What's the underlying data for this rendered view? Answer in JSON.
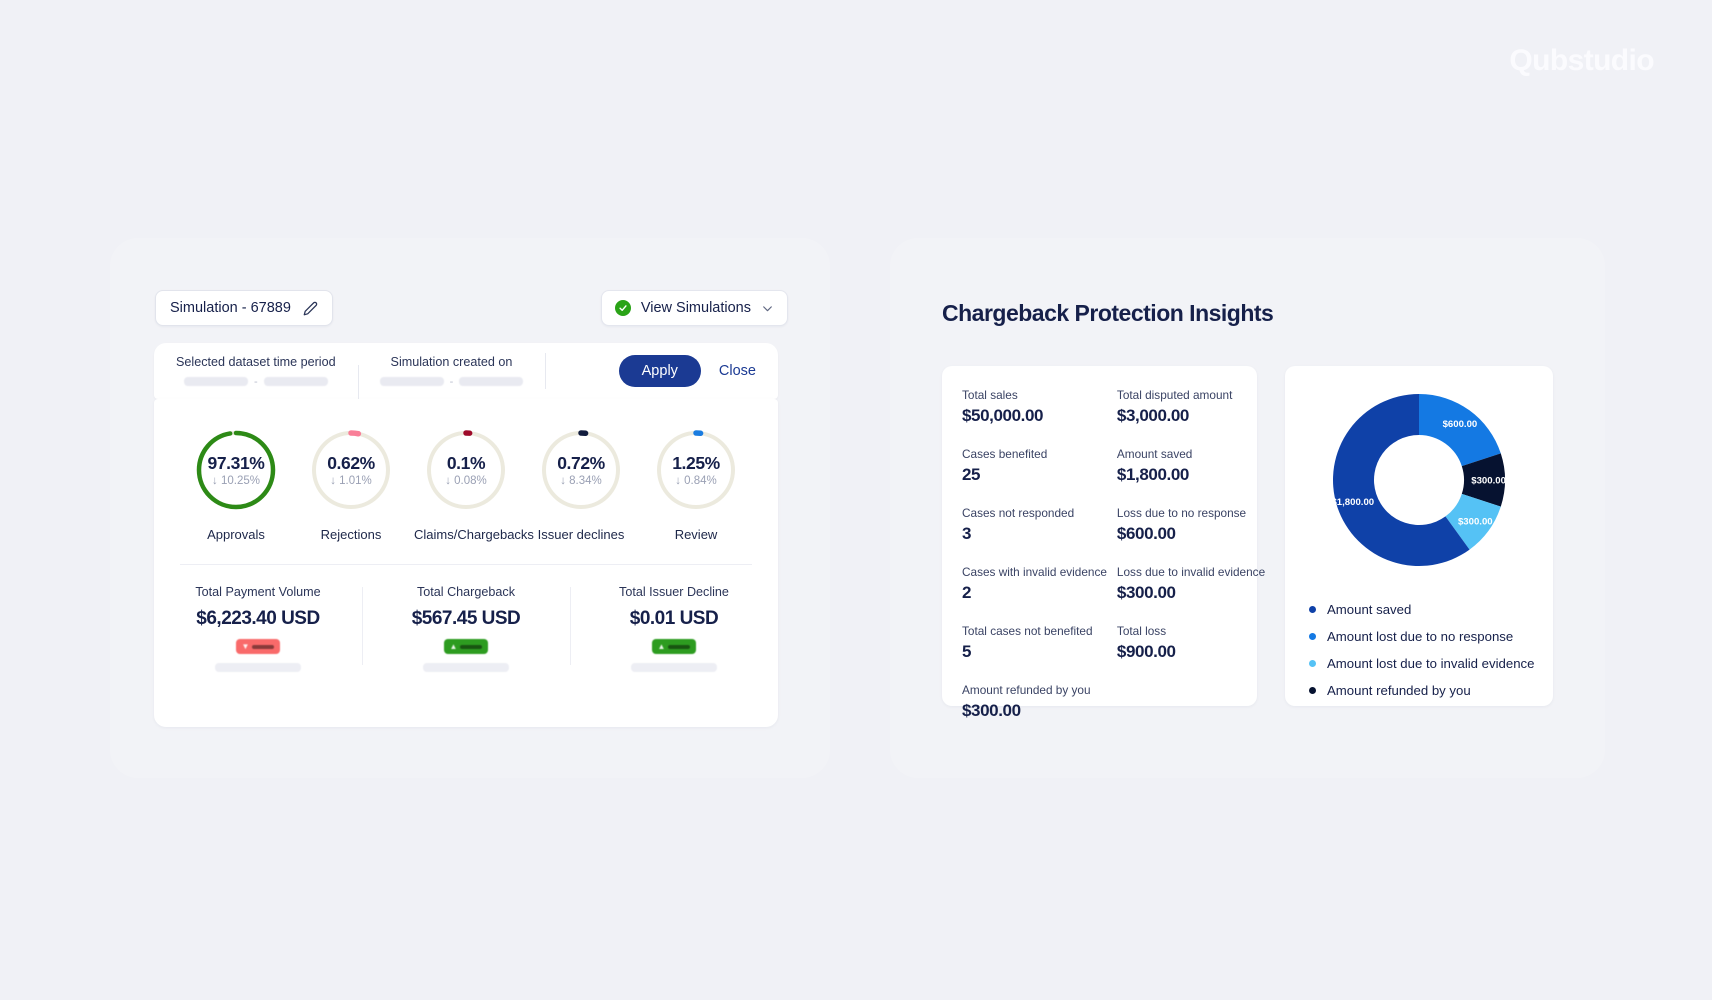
{
  "brand": "Qubstudio",
  "left_panel": {
    "simulation_chip": {
      "label": "Simulation - 67889",
      "edit_icon": "pencil-icon"
    },
    "view_simulations": {
      "label": "View Simulations",
      "status_icon": "check-circle-icon",
      "chevron_icon": "chevron-down-icon"
    },
    "filter_bar": {
      "col1_label": "Selected dataset time period",
      "col2_label": "Simulation created on",
      "range_separator": "-",
      "apply_label": "Apply",
      "close_label": "Close"
    },
    "gauges": [
      {
        "name": "Approvals",
        "percent": "97.31%",
        "delta": "↓ 10.25%",
        "value": 97.31,
        "color": "#2d8a16"
      },
      {
        "name": "Rejections",
        "percent": "0.62%",
        "delta": "↓ 1.01%",
        "value": 3.2,
        "color": "#f97f98"
      },
      {
        "name": "Claims/Chargebacks",
        "percent": "0.1%",
        "delta": "↓ 0.08%",
        "value": 1.6,
        "color": "#9e0b2a"
      },
      {
        "name": "Issuer declines",
        "percent": "0.72%",
        "delta": "↓ 8.34%",
        "value": 2.0,
        "color": "#111c3d"
      },
      {
        "name": "Review",
        "percent": "1.25%",
        "delta": "↓ 0.84%",
        "value": 2.0,
        "color": "#1a7ce0"
      }
    ],
    "gauge_track_color": "#eceade",
    "totals": [
      {
        "label": "Total Payment Volume",
        "value": "$6,223.40 USD",
        "trend": "down"
      },
      {
        "label": "Total Chargeback",
        "value": "$567.45 USD",
        "trend": "up"
      },
      {
        "label": "Total Issuer Decline",
        "value": "$0.01 USD",
        "trend": "up"
      }
    ]
  },
  "right_panel": {
    "title": "Chargeback Protection Insights",
    "stats": [
      {
        "label": "Total sales",
        "value": "$50,000.00"
      },
      {
        "label": "Total disputed amount",
        "value": "$3,000.00"
      },
      {
        "label": "Cases benefited",
        "value": "25"
      },
      {
        "label": "Amount saved",
        "value": "$1,800.00"
      },
      {
        "label": "Cases not responded",
        "value": "3"
      },
      {
        "label": "Loss due to no response",
        "value": "$600.00"
      },
      {
        "label": "Cases with invalid evidence",
        "value": "2"
      },
      {
        "label": "Loss due to invalid evidence",
        "value": "$300.00"
      },
      {
        "label": "Total cases not benefited",
        "value": "5"
      },
      {
        "label": "Total loss",
        "value": "$900.00"
      },
      {
        "label": "Amount refunded by you",
        "value": "$300.00"
      }
    ]
  },
  "chart_data": {
    "type": "pie",
    "title": "Chargeback Protection Insights",
    "subtype": "donut",
    "legend_position": "bottom",
    "categories": [
      "Amount saved",
      "Amount lost due to no response",
      "Amount lost due to invalid evidence",
      "Amount refunded by you"
    ],
    "values": [
      1800,
      600,
      300,
      300
    ],
    "labels": [
      "$1,800.00",
      "$600.00",
      "$300.00",
      "$300.00"
    ],
    "colors": [
      "#0f41a8",
      "#1479e3",
      "#55c2f5",
      "#061230"
    ],
    "total": 3000,
    "unit": "USD",
    "slice_order_from_top_clockwise": [
      {
        "name": "Amount lost due to no response",
        "value": 600,
        "label": "$600.00",
        "color": "#1479e3"
      },
      {
        "name": "Amount refunded by you",
        "value": 300,
        "label": "$300.00",
        "color": "#061230"
      },
      {
        "name": "Amount lost due to invalid evidence",
        "value": 300,
        "label": "$300.00",
        "color": "#55c2f5"
      },
      {
        "name": "Amount saved",
        "value": 1800,
        "label": "$1,800.00",
        "color": "#0f41a8"
      }
    ]
  }
}
